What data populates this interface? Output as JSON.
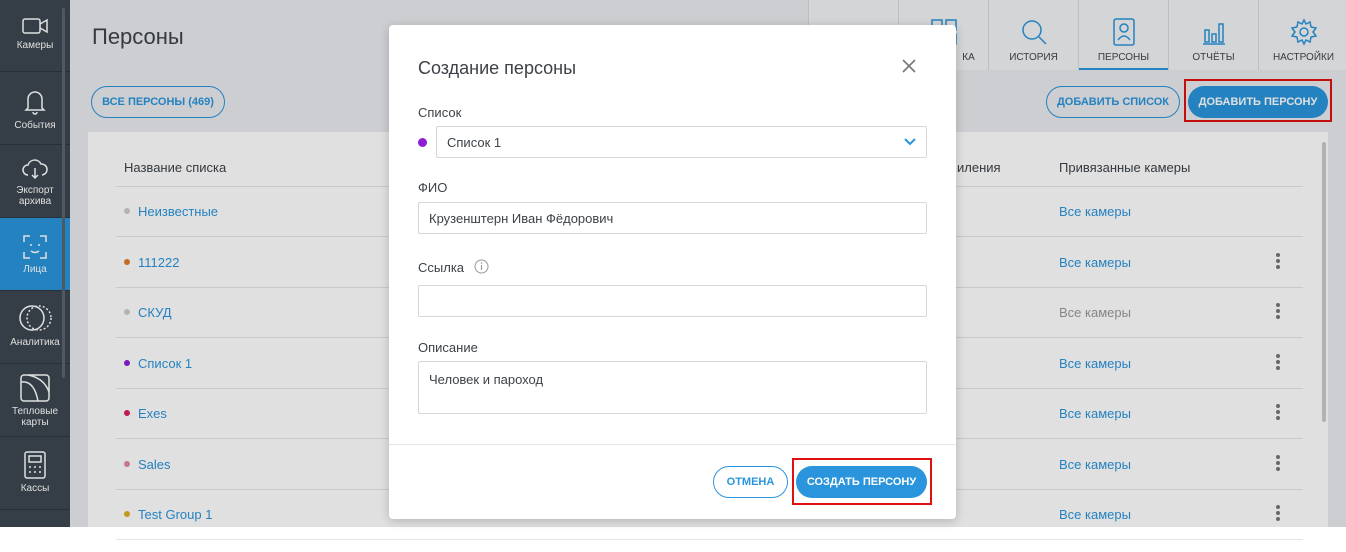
{
  "sidebar": {
    "items": [
      {
        "label": "Камеры",
        "icon": "camera-icon"
      },
      {
        "label": "События",
        "icon": "bell-icon"
      },
      {
        "label": "Экспорт архива",
        "icon": "cloud-download-icon"
      },
      {
        "label": "Лица",
        "icon": "face-scan-icon"
      },
      {
        "label": "Аналитика",
        "icon": "analytics-icon"
      },
      {
        "label": "Тепловые карты",
        "icon": "heatmap-icon"
      },
      {
        "label": "Кассы",
        "icon": "cash-register-icon"
      }
    ],
    "active": "Лица"
  },
  "header": {
    "title": "Персоны",
    "tabs": [
      {
        "label": "",
        "icon": "scan-icon"
      },
      {
        "label": "КА",
        "icon": "gallery-icon"
      },
      {
        "label": "ИСТОРИЯ",
        "icon": "search-icon"
      },
      {
        "label": "ПЕРСОНЫ",
        "icon": "person-card-icon"
      },
      {
        "label": "ОТЧЁТЫ",
        "icon": "bar-chart-icon"
      },
      {
        "label": "НАСТРОЙКИ",
        "icon": "gear-icon"
      }
    ],
    "active_tab": "ПЕРСОНЫ"
  },
  "toolbar": {
    "all_persons": "ВСЕ ПЕРСОНЫ (469)",
    "add_list": "ДОБАВИТЬ СПИСОК",
    "add_person": "ДОБАВИТЬ ПЕРСОНУ"
  },
  "table": {
    "col_name": "Название списка",
    "col_partial": "иления",
    "col_cameras": "Привязанные камеры",
    "rows": [
      {
        "name": "Неизвестные",
        "color": "#cccccc",
        "cameras": "Все камеры",
        "cam_active": true,
        "menu": false
      },
      {
        "name": "111222",
        "color": "#e07a2a",
        "cameras": "Все камеры",
        "cam_active": true,
        "menu": true
      },
      {
        "name": "СКУД",
        "color": "#cccccc",
        "cameras": "Все камеры",
        "cam_active": false,
        "menu": true
      },
      {
        "name": "Список 1",
        "color": "#8a1fd6",
        "cameras": "Все камеры",
        "cam_active": true,
        "menu": true
      },
      {
        "name": "Exes",
        "color": "#d6245a",
        "cameras": "Все камеры",
        "cam_active": true,
        "menu": true
      },
      {
        "name": "Sales",
        "color": "#e08aa8",
        "cameras": "Все камеры",
        "cam_active": true,
        "menu": true
      },
      {
        "name": "Test Group 1",
        "color": "#e0b020",
        "cameras": "Все камеры",
        "cam_active": true,
        "menu": true
      }
    ]
  },
  "modal": {
    "title": "Создание персоны",
    "list_label": "Список",
    "list_value": "Список 1",
    "list_color": "#8a1fd6",
    "fio_label": "ФИО",
    "fio_value": "Крузенштерн Иван Фёдорович",
    "link_label": "Ссылка",
    "link_value": "",
    "desc_label": "Описание",
    "desc_value": "Человек и пароход",
    "cancel": "ОТМЕНА",
    "submit": "СОЗДАТЬ ПЕРСОНУ"
  },
  "colors": {
    "accent": "#2a95dc",
    "sidebar": "#3d4650",
    "highlight": "#e01010"
  }
}
